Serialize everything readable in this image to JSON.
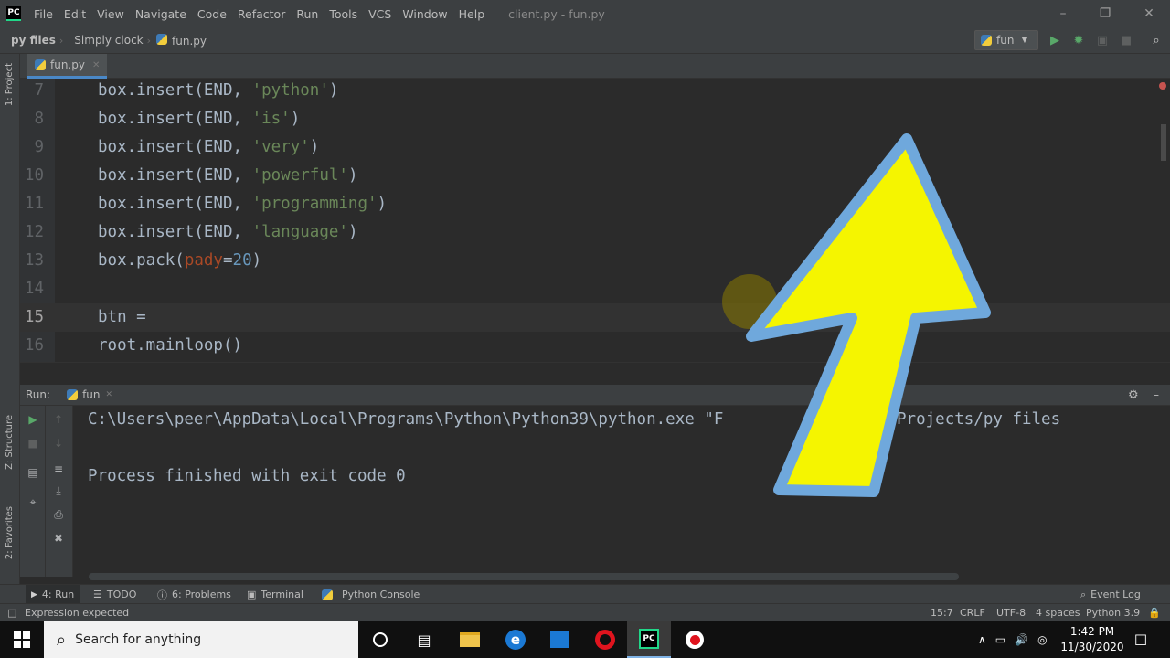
{
  "window": {
    "file_title": "client.py - fun.py",
    "menu": [
      "File",
      "Edit",
      "View",
      "Navigate",
      "Code",
      "Refactor",
      "Run",
      "Tools",
      "VCS",
      "Window",
      "Help"
    ]
  },
  "breadcrumbs": [
    "py files",
    "Simply clock",
    "fun.py"
  ],
  "run_config": "fun",
  "left_strip": {
    "project": "1: Project",
    "structure": "Z: Structure",
    "favorites": "2: Favorites"
  },
  "editor": {
    "tab": "fun.py",
    "lines": [
      {
        "n": "7",
        "code_prefix": "box.insert(END, ",
        "str": "'python'",
        "suffix": ")"
      },
      {
        "n": "8",
        "code_prefix": "box.insert(END, ",
        "str": "'is'",
        "suffix": ")"
      },
      {
        "n": "9",
        "code_prefix": "box.insert(END, ",
        "str": "'very'",
        "suffix": ")"
      },
      {
        "n": "10",
        "code_prefix": "box.insert(END, ",
        "str": "'powerful'",
        "suffix": ")"
      },
      {
        "n": "11",
        "code_prefix": "box.insert(END, ",
        "str": "'programming'",
        "suffix": ")"
      },
      {
        "n": "12",
        "code_prefix": "box.insert(END, ",
        "str": "'language'",
        "suffix": ")"
      },
      {
        "n": "13",
        "code_prefix": "box.pack(",
        "kwarg": "pady",
        "eq": "=",
        "num": "20",
        "suffix": ")"
      },
      {
        "n": "14"
      },
      {
        "n": "15",
        "plain": "btn ="
      },
      {
        "n": "16",
        "plain": "root.mainloop()"
      }
    ]
  },
  "run_panel": {
    "label": "Run:",
    "tab": "fun",
    "output": [
      "C:\\Users\\peer\\AppData\\Local\\Programs\\Python\\Python39\\python.exe \"F         S/Python Projects/py files",
      "",
      "Process finished with exit code 0"
    ]
  },
  "tool_buttons": {
    "run": "4: Run",
    "todo": "TODO",
    "problems": "6: Problems",
    "terminal": "Terminal",
    "python_console": "Python Console",
    "event_log": "Event Log"
  },
  "status": {
    "message": "Expression expected",
    "position": "15:7",
    "line_sep": "CRLF",
    "encoding": "UTF-8",
    "indent": "4 spaces",
    "interpreter": "Python 3.9"
  },
  "taskbar": {
    "search_placeholder": "Search for anything",
    "time": "1:42 PM",
    "date": "11/30/2020"
  },
  "colors": {
    "arrow_fill": "#f5f500",
    "arrow_outline": "#6fa8dc"
  }
}
